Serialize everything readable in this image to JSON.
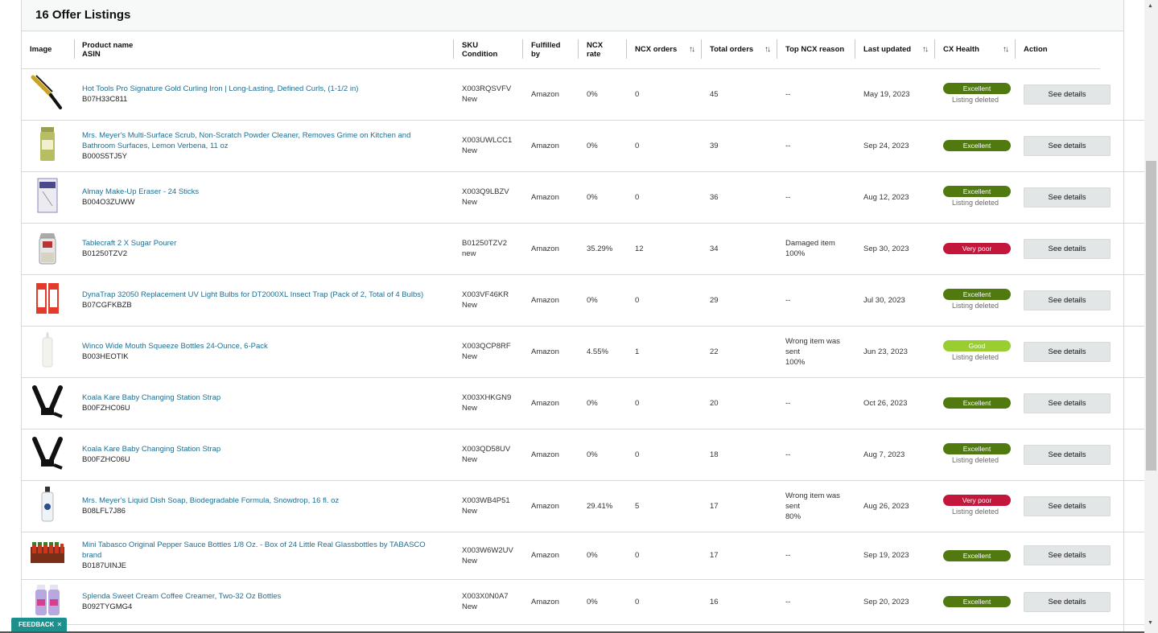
{
  "panel": {
    "title": "16 Offer Listings"
  },
  "columns": {
    "image": "Image",
    "product_name": "Product name",
    "asin": "ASIN",
    "sku": "SKU",
    "condition": "Condition",
    "fulfilled_by": "Fulfilled by",
    "ncx_rate": "NCX rate",
    "ncx_orders": "NCX orders",
    "total_orders": "Total orders",
    "top_ncx_reason": "Top NCX reason",
    "last_updated": "Last updated",
    "cx_health": "CX Health",
    "action": "Action"
  },
  "sort_icon": "↑↓",
  "rows": [
    {
      "image_icon": "curling-iron-icon",
      "name": "Hot Tools Pro Signature Gold Curling Iron | Long-Lasting, Defined Curls, (1-1/2 in)",
      "asin": "B07H33C811",
      "sku": "X003RQSVFV",
      "condition": "New",
      "fulfilled": "Amazon",
      "rate": "0%",
      "orders": "0",
      "total": "45",
      "reason": "--",
      "reason_pct": "",
      "updated": "May 19, 2023",
      "health": "Excellent",
      "health_color": "#507a10",
      "status": "Listing deleted",
      "action": "See details"
    },
    {
      "image_icon": "scrub-bottle-icon",
      "name": "Mrs. Meyer's Multi-Surface Scrub, Non-Scratch Powder Cleaner, Removes Grime on Kitchen and Bathroom Surfaces, Lemon Verbena, 11 oz",
      "asin": "B000S5TJ5Y",
      "sku": "X003UWLCC1",
      "condition": "New",
      "fulfilled": "Amazon",
      "rate": "0%",
      "orders": "0",
      "total": "39",
      "reason": "--",
      "reason_pct": "",
      "updated": "Sep 24, 2023",
      "health": "Excellent",
      "health_color": "#507a10",
      "status": "",
      "action": "See details"
    },
    {
      "image_icon": "makeup-eraser-icon",
      "name": "Almay Make-Up Eraser - 24 Sticks",
      "asin": "B004O3ZUWW",
      "sku": "X003Q9LBZV",
      "condition": "New",
      "fulfilled": "Amazon",
      "rate": "0%",
      "orders": "0",
      "total": "36",
      "reason": "--",
      "reason_pct": "",
      "updated": "Aug 12, 2023",
      "health": "Excellent",
      "health_color": "#507a10",
      "status": "Listing deleted",
      "action": "See details"
    },
    {
      "image_icon": "sugar-pourer-icon",
      "name": "Tablecraft 2 X Sugar Pourer",
      "asin": "B01250TZV2",
      "sku": "B01250TZV2",
      "condition": "new",
      "fulfilled": "Amazon",
      "rate": "35.29%",
      "orders": "12",
      "total": "34",
      "reason": "Damaged item",
      "reason_pct": "100%",
      "updated": "Sep 30, 2023",
      "health": "Very poor",
      "health_color": "#c4163a",
      "status": "",
      "action": "See details"
    },
    {
      "image_icon": "uv-bulb-icon",
      "name": "DynaTrap 32050 Replacement UV Light Bulbs for DT2000XL Insect Trap (Pack of 2, Total of 4 Bulbs)",
      "asin": "B07CGFKBZB",
      "sku": "X003VF46KR",
      "condition": "New",
      "fulfilled": "Amazon",
      "rate": "0%",
      "orders": "0",
      "total": "29",
      "reason": "--",
      "reason_pct": "",
      "updated": "Jul 30, 2023",
      "health": "Excellent",
      "health_color": "#507a10",
      "status": "Listing deleted",
      "action": "See details"
    },
    {
      "image_icon": "squeeze-bottle-icon",
      "name": "Winco Wide Mouth Squeeze Bottles 24-Ounce, 6-Pack",
      "asin": "B003HEOTIK",
      "sku": "X003QCP8RF",
      "condition": "New",
      "fulfilled": "Amazon",
      "rate": "4.55%",
      "orders": "1",
      "total": "22",
      "reason": "Wrong item was sent",
      "reason_pct": "100%",
      "updated": "Jun 23, 2023",
      "health": "Good",
      "health_color": "#9acd32",
      "status": "Listing deleted",
      "action": "See details"
    },
    {
      "image_icon": "strap-icon",
      "name": "Koala Kare Baby Changing Station Strap",
      "asin": "B00FZHC06U",
      "sku": "X003XHKGN9",
      "condition": "New",
      "fulfilled": "Amazon",
      "rate": "0%",
      "orders": "0",
      "total": "20",
      "reason": "--",
      "reason_pct": "",
      "updated": "Oct 26, 2023",
      "health": "Excellent",
      "health_color": "#507a10",
      "status": "",
      "action": "See details"
    },
    {
      "image_icon": "strap-icon",
      "name": "Koala Kare Baby Changing Station Strap",
      "asin": "B00FZHC06U",
      "sku": "X003QD58UV",
      "condition": "New",
      "fulfilled": "Amazon",
      "rate": "0%",
      "orders": "0",
      "total": "18",
      "reason": "--",
      "reason_pct": "",
      "updated": "Aug 7, 2023",
      "health": "Excellent",
      "health_color": "#507a10",
      "status": "Listing deleted",
      "action": "See details"
    },
    {
      "image_icon": "dish-soap-icon",
      "name": "Mrs. Meyer's Liquid Dish Soap, Biodegradable Formula, Snowdrop, 16 fl. oz",
      "asin": "B08LFL7J86",
      "sku": "X003WB4P51",
      "condition": "New",
      "fulfilled": "Amazon",
      "rate": "29.41%",
      "orders": "5",
      "total": "17",
      "reason": "Wrong item was sent",
      "reason_pct": "80%",
      "updated": "Aug 26, 2023",
      "health": "Very poor",
      "health_color": "#c4163a",
      "status": "Listing deleted",
      "action": "See details"
    },
    {
      "image_icon": "tabasco-box-icon",
      "name": "Mini Tabasco Original Pepper Sauce Bottles 1/8 Oz. - Box of 24 Little Real Glassbottles by TABASCO brand",
      "asin": "B0187UINJE",
      "sku": "X003W6W2UV",
      "condition": "New",
      "fulfilled": "Amazon",
      "rate": "0%",
      "orders": "0",
      "total": "17",
      "reason": "--",
      "reason_pct": "",
      "updated": "Sep 19, 2023",
      "health": "Excellent",
      "health_color": "#507a10",
      "status": "",
      "action": "See details"
    },
    {
      "image_icon": "creamer-bottles-icon",
      "name": "Splenda Sweet Cream Coffee Creamer, Two-32 Oz Bottles",
      "asin": "B092TYGMG4",
      "sku": "X003X0N0A7",
      "condition": "New",
      "fulfilled": "Amazon",
      "rate": "0%",
      "orders": "0",
      "total": "16",
      "reason": "--",
      "reason_pct": "",
      "updated": "Sep 20, 2023",
      "health": "Excellent",
      "health_color": "#507a10",
      "status": "",
      "action": "See details"
    }
  ],
  "feedback": {
    "label": "FEEDBACK",
    "close": "✕"
  },
  "scrollbar": {
    "up": "▲",
    "down": "▼"
  }
}
